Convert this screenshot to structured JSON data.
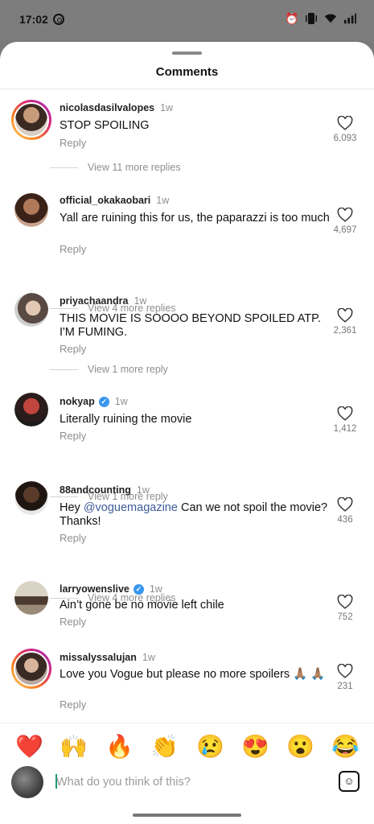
{
  "status_bar": {
    "time": "17:02"
  },
  "sheet": {
    "title": "Comments"
  },
  "comments": [
    {
      "username": "nicolasdasilvalopes",
      "time": "1w",
      "verified": false,
      "text": "STOP SPOILING",
      "reply_label": "Reply",
      "likes": "6,093",
      "view_replies": "View 11 more replies"
    },
    {
      "username": "official_okakaobari",
      "time": "1w",
      "verified": false,
      "text": "Yall are ruining this for us, the paparazzi is too much",
      "reply_label": "Reply",
      "likes": "4,697",
      "view_replies": "View 4 more replies"
    },
    {
      "username": "priyachaandra",
      "time": "1w",
      "verified": false,
      "text": "THIS MOVIE IS SOOOO BEYOND SPOILED ATP. I'M FUMING.",
      "reply_label": "Reply",
      "likes": "2,361",
      "view_replies": "View 1 more reply"
    },
    {
      "username": "nokyap",
      "time": "1w",
      "verified": true,
      "text": "Literally ruining the movie",
      "reply_label": "Reply",
      "likes": "1,412",
      "view_replies": "View 1 more reply"
    },
    {
      "username": "88andcounting",
      "time": "1w",
      "verified": false,
      "text_before": "Hey ",
      "mention": "@voguemagazine",
      "text_after": " Can we not spoil the movie? Thanks!",
      "reply_label": "Reply",
      "likes": "436",
      "view_replies": "View 4 more replies"
    },
    {
      "username": "larryowenslive",
      "time": "1w",
      "verified": true,
      "text": "Ain’t gone be no movie left chile",
      "reply_label": "Reply",
      "likes": "752"
    },
    {
      "username": "missalyssalujan",
      "time": "1w",
      "verified": false,
      "text": "Love you Vogue but please no more spoilers 🙏🏽 🙏🏽",
      "reply_label": "Reply",
      "likes": "231"
    }
  ],
  "emoji_bar": [
    "❤️",
    "🙌",
    "🔥",
    "👏",
    "😢",
    "😍",
    "😮",
    "😂"
  ],
  "composer": {
    "placeholder": "What do you think of this?"
  },
  "colors": {
    "link": "#3d5a98",
    "verified": "#3897f0",
    "muted": "#8e8e8e"
  },
  "icons": [
    "heart-icon",
    "verified-icon",
    "sticker-icon",
    "alarm-icon",
    "vibrate-icon",
    "wifi-icon",
    "signal-icon"
  ]
}
